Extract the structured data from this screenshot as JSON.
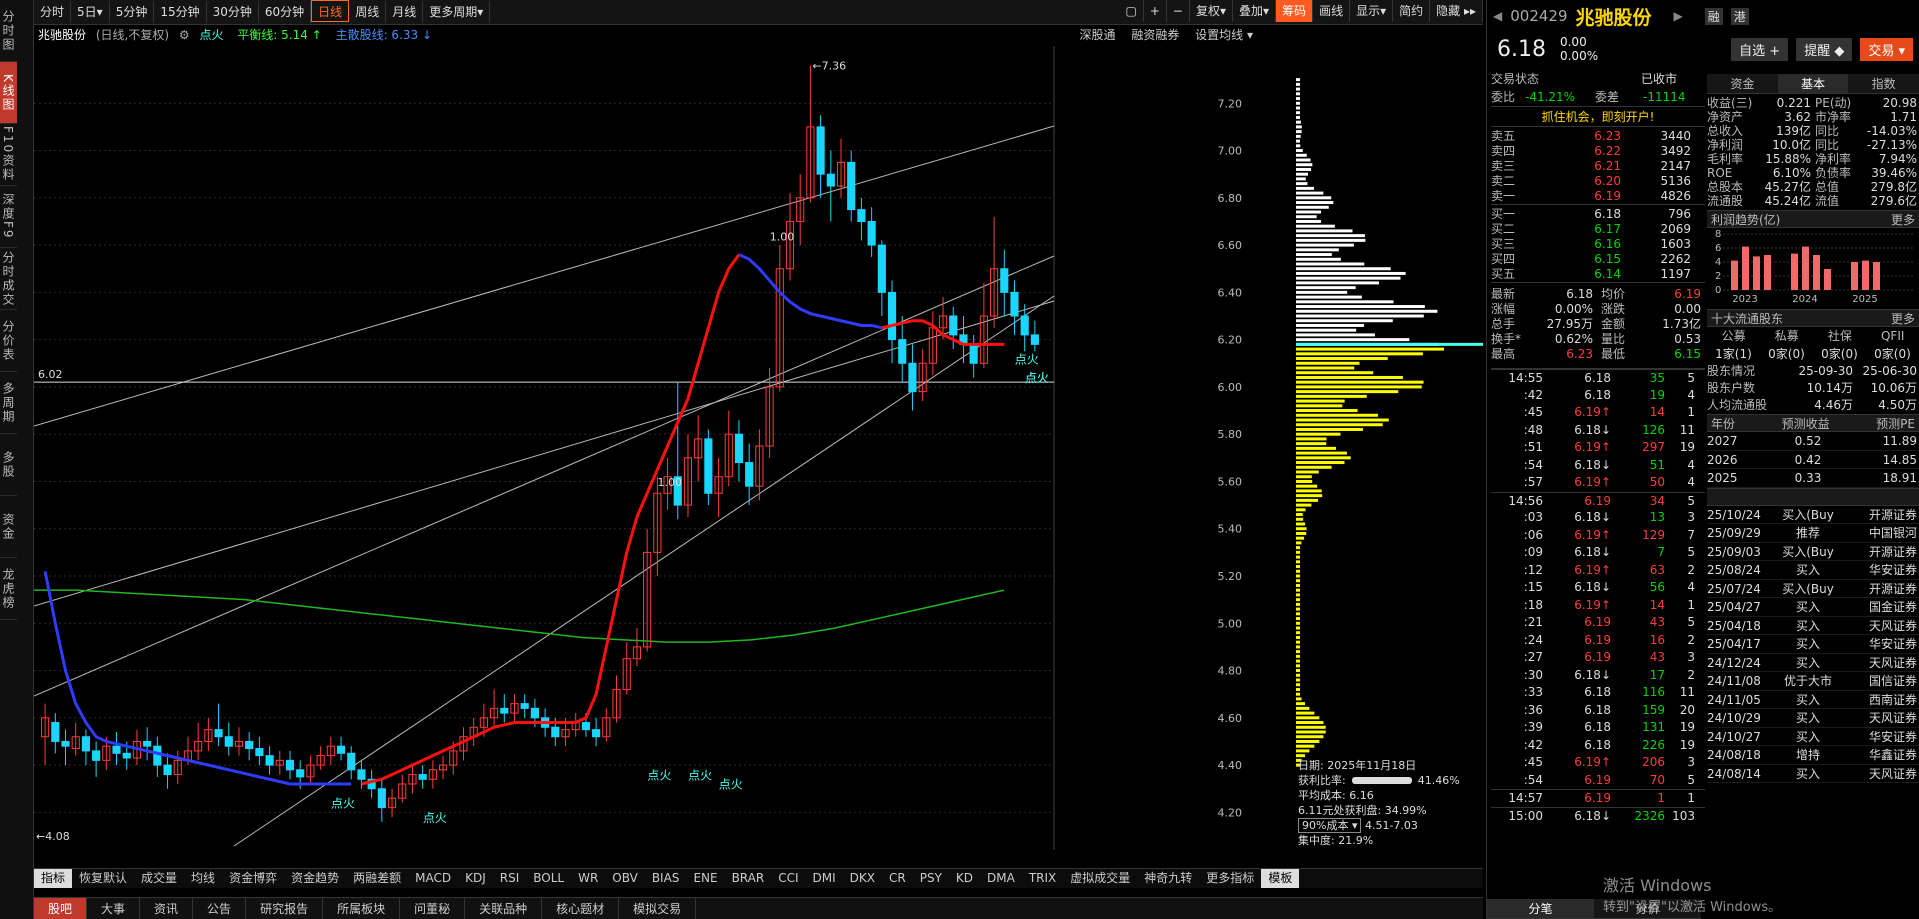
{
  "nav": [
    "分时图",
    "K线图",
    "F10资料",
    "深度F9",
    "分时成交",
    "分价表",
    "多周期",
    "多股",
    "资金",
    "龙虎榜"
  ],
  "nav_active": 1,
  "toolbar": {
    "left": [
      {
        "label": "分时"
      },
      {
        "label": "5日▾"
      },
      {
        "label": "5分钟"
      },
      {
        "label": "15分钟"
      },
      {
        "label": "30分钟"
      },
      {
        "label": "60分钟"
      },
      {
        "label": "日线",
        "active": true
      },
      {
        "label": "周线"
      },
      {
        "label": "月线"
      },
      {
        "label": "更多周期▾"
      }
    ],
    "right": [
      {
        "label": "▢"
      },
      {
        "label": "+"
      },
      {
        "label": "−"
      },
      {
        "label": "复权▾"
      },
      {
        "label": "叠加▾"
      },
      {
        "label": "筹码",
        "active": true
      },
      {
        "label": "画线"
      },
      {
        "label": "显示▾"
      },
      {
        "label": "简约"
      },
      {
        "label": "隐藏 ▸▸"
      }
    ]
  },
  "title": {
    "name": "兆驰股份",
    "mode": "(日线,不复权)",
    "gear": "⚙",
    "dianhuo": "点火",
    "pingheng": "平衡线: 5.14 ↑",
    "zhuli": "主散股线: 6.33 ↓",
    "right1": "深股通",
    "right2": "融资融券",
    "right3": "设置均线 ▾"
  },
  "chart_data": {
    "type": "candlestick",
    "title": "",
    "ylim": [
      4.1,
      7.4
    ],
    "yticks": [
      "7.20",
      "7.00",
      "6.80",
      "6.60",
      "6.40",
      "6.20",
      "6.00",
      "5.80",
      "5.60",
      "5.40",
      "5.20",
      "5.00",
      "4.80",
      "4.60",
      "4.40",
      "4.20"
    ],
    "hline": "6.02",
    "high_label": "←7.36",
    "low_label": "←4.08",
    "labels": [
      "1.00",
      "1.00"
    ],
    "dianhuo_labels": [
      "点火",
      "点火",
      "点火",
      "点火",
      "点火",
      "点火",
      "点火",
      "点火"
    ],
    "candles": [
      [
        4.52,
        4.6,
        4.66,
        4.4
      ],
      [
        4.58,
        4.5,
        4.62,
        4.45
      ],
      [
        4.5,
        4.48,
        4.55,
        4.4
      ],
      [
        4.47,
        4.52,
        4.58,
        4.44
      ],
      [
        4.52,
        4.46,
        4.55,
        4.4
      ],
      [
        4.46,
        4.42,
        4.5,
        4.35
      ],
      [
        4.42,
        4.48,
        4.52,
        4.38
      ],
      [
        4.48,
        4.45,
        4.54,
        4.4
      ],
      [
        4.45,
        4.43,
        4.5,
        4.38
      ],
      [
        4.43,
        4.5,
        4.55,
        4.4
      ],
      [
        4.5,
        4.48,
        4.56,
        4.42
      ],
      [
        4.48,
        4.4,
        4.52,
        4.35
      ],
      [
        4.4,
        4.36,
        4.45,
        4.3
      ],
      [
        4.36,
        4.42,
        4.46,
        4.32
      ],
      [
        4.42,
        4.46,
        4.52,
        4.4
      ],
      [
        4.46,
        4.5,
        4.58,
        4.42
      ],
      [
        4.5,
        4.55,
        4.6,
        4.46
      ],
      [
        4.55,
        4.52,
        4.66,
        4.48
      ],
      [
        4.52,
        4.48,
        4.58,
        4.44
      ],
      [
        4.48,
        4.5,
        4.56,
        4.44
      ],
      [
        4.5,
        4.47,
        4.54,
        4.42
      ],
      [
        4.47,
        4.44,
        4.52,
        4.4
      ],
      [
        4.44,
        4.4,
        4.48,
        4.36
      ],
      [
        4.4,
        4.42,
        4.46,
        4.36
      ],
      [
        4.42,
        4.38,
        4.46,
        4.34
      ],
      [
        4.38,
        4.35,
        4.42,
        4.3
      ],
      [
        4.35,
        4.4,
        4.44,
        4.32
      ],
      [
        4.4,
        4.44,
        4.48,
        4.38
      ],
      [
        4.44,
        4.48,
        4.52,
        4.4
      ],
      [
        4.48,
        4.45,
        4.52,
        4.42
      ],
      [
        4.45,
        4.38,
        4.48,
        4.34
      ],
      [
        4.38,
        4.34,
        4.42,
        4.3
      ],
      [
        4.34,
        4.3,
        4.38,
        4.26
      ],
      [
        4.3,
        4.22,
        4.34,
        4.16
      ],
      [
        4.22,
        4.26,
        4.3,
        4.18
      ],
      [
        4.26,
        4.32,
        4.36,
        4.24
      ],
      [
        4.32,
        4.36,
        4.4,
        4.28
      ],
      [
        4.36,
        4.34,
        4.4,
        4.3
      ],
      [
        4.34,
        4.38,
        4.42,
        4.3
      ],
      [
        4.38,
        4.4,
        4.44,
        4.34
      ],
      [
        4.4,
        4.46,
        4.5,
        4.36
      ],
      [
        4.46,
        4.52,
        4.56,
        4.42
      ],
      [
        4.52,
        4.56,
        4.6,
        4.48
      ],
      [
        4.56,
        4.6,
        4.66,
        4.52
      ],
      [
        4.6,
        4.64,
        4.72,
        4.56
      ],
      [
        4.64,
        4.62,
        4.7,
        4.58
      ],
      [
        4.62,
        4.66,
        4.7,
        4.58
      ],
      [
        4.66,
        4.64,
        4.7,
        4.6
      ],
      [
        4.64,
        4.6,
        4.68,
        4.56
      ],
      [
        4.6,
        4.56,
        4.64,
        4.52
      ],
      [
        4.56,
        4.52,
        4.6,
        4.48
      ],
      [
        4.52,
        4.55,
        4.6,
        4.48
      ],
      [
        4.55,
        4.58,
        4.62,
        4.52
      ],
      [
        4.58,
        4.55,
        4.62,
        4.52
      ],
      [
        4.55,
        4.52,
        4.6,
        4.48
      ],
      [
        4.52,
        4.6,
        4.64,
        4.5
      ],
      [
        4.6,
        4.72,
        4.78,
        4.58
      ],
      [
        4.72,
        4.85,
        4.92,
        4.7
      ],
      [
        4.85,
        4.9,
        4.98,
        4.82
      ],
      [
        4.9,
        5.3,
        5.4,
        4.88
      ],
      [
        5.3,
        5.55,
        5.62,
        5.2
      ],
      [
        5.55,
        5.62,
        5.7,
        5.48
      ],
      [
        5.62,
        5.5,
        6.02,
        5.44
      ],
      [
        5.5,
        5.7,
        5.8,
        5.45
      ],
      [
        5.7,
        5.78,
        5.88,
        5.6
      ],
      [
        5.78,
        5.55,
        5.82,
        5.5
      ],
      [
        5.55,
        5.62,
        5.7,
        5.45
      ],
      [
        5.62,
        5.8,
        5.9,
        5.58
      ],
      [
        5.8,
        5.68,
        5.86,
        5.6
      ],
      [
        5.68,
        5.58,
        5.76,
        5.5
      ],
      [
        5.58,
        5.75,
        5.82,
        5.52
      ],
      [
        5.75,
        6.0,
        6.08,
        5.7
      ],
      [
        6.0,
        6.5,
        6.6,
        5.98
      ],
      [
        6.5,
        6.7,
        6.82,
        6.45
      ],
      [
        6.7,
        6.8,
        6.9,
        6.6
      ],
      [
        6.8,
        7.1,
        7.36,
        6.78
      ],
      [
        7.1,
        6.9,
        7.15,
        6.8
      ],
      [
        6.9,
        6.85,
        7.0,
        6.7
      ],
      [
        6.85,
        6.95,
        7.05,
        6.8
      ],
      [
        6.95,
        6.75,
        7.0,
        6.7
      ],
      [
        6.75,
        6.7,
        6.8,
        6.62
      ],
      [
        6.7,
        6.6,
        6.76,
        6.55
      ],
      [
        6.6,
        6.4,
        6.62,
        6.3
      ],
      [
        6.4,
        6.2,
        6.45,
        6.1
      ],
      [
        6.2,
        6.1,
        6.3,
        6.02
      ],
      [
        6.1,
        5.98,
        6.18,
        5.9
      ],
      [
        5.98,
        6.1,
        6.16,
        5.94
      ],
      [
        6.1,
        6.25,
        6.32,
        6.05
      ],
      [
        6.25,
        6.3,
        6.38,
        6.2
      ],
      [
        6.3,
        6.22,
        6.34,
        6.16
      ],
      [
        6.22,
        6.18,
        6.3,
        6.1
      ],
      [
        6.18,
        6.1,
        6.22,
        6.04
      ],
      [
        6.1,
        6.3,
        6.44,
        6.08
      ],
      [
        6.3,
        6.5,
        6.72,
        6.25
      ],
      [
        6.5,
        6.4,
        6.58,
        6.3
      ],
      [
        6.4,
        6.3,
        6.45,
        6.22
      ],
      [
        6.3,
        6.22,
        6.35,
        6.15
      ],
      [
        6.22,
        6.18,
        6.28,
        6.15
      ]
    ],
    "ma_blue": [
      5.22,
      5.0,
      4.8,
      4.66,
      4.58,
      4.52,
      4.5,
      4.49,
      4.48,
      4.47,
      4.46,
      4.45,
      4.44,
      4.43,
      4.42,
      4.41,
      4.4,
      4.39,
      4.38,
      4.37,
      4.36,
      4.35,
      4.34,
      4.33,
      4.32,
      4.32,
      4.32,
      4.32,
      4.32,
      4.32,
      4.32
    ],
    "ma_red_start": 31,
    "ma_red": [
      4.32,
      4.33,
      4.34,
      4.36,
      4.38,
      4.4,
      4.42,
      4.44,
      4.46,
      4.48,
      4.5,
      4.52,
      4.54,
      4.56,
      4.57,
      4.58,
      4.58,
      4.58,
      4.58,
      4.58,
      4.58,
      4.58,
      4.6,
      4.7,
      4.9,
      5.1,
      5.3,
      5.45,
      5.55,
      5.65,
      5.75,
      5.85,
      5.95,
      6.1,
      6.25,
      6.4,
      6.5,
      6.56
    ],
    "ma_blue2_start": 68,
    "ma_blue2": [
      6.56,
      6.54,
      6.5,
      6.45,
      6.4,
      6.36,
      6.33,
      6.31,
      6.3,
      6.29,
      6.28,
      6.27,
      6.26,
      6.26,
      6.25
    ],
    "ma_red2_start": 82,
    "ma_red2": [
      6.25,
      6.26,
      6.27,
      6.28,
      6.28,
      6.26,
      6.22,
      6.2,
      6.18,
      6.18,
      6.18,
      6.18,
      6.18
    ],
    "green_line": [
      5.14,
      5.14,
      5.13,
      5.12,
      5.11,
      5.1,
      5.08,
      5.06,
      5.04,
      5.02,
      5.0,
      4.98,
      4.96,
      4.94,
      4.93,
      4.92,
      4.92,
      4.93,
      4.95,
      4.98,
      5.02,
      5.06,
      5.1,
      5.14
    ],
    "profile": {
      "date": "日期: 2025年11月18日",
      "win_rate": "获利比率:",
      "win_val": "41.46%",
      "avg": "平均成本: 6.16",
      "avg2": "6.11元处获利盘: 34.99%",
      "cost": "90%成本 ▾",
      "cost_range": "4.51-7.03",
      "concentration": "集中度: 21.9%"
    }
  },
  "bottom_tabs": [
    "指标",
    "恢复默认",
    "成交量",
    "均线",
    "资金博弈",
    "资金趋势",
    "两融差额",
    "MACD",
    "KDJ",
    "RSI",
    "BOLL",
    "WR",
    "OBV",
    "BIAS",
    "ENE",
    "BRAR",
    "CCI",
    "DMI",
    "DKX",
    "CR",
    "PSY",
    "KD",
    "DMA",
    "TRIX",
    "虚拟成交量",
    "神奇九转",
    "更多指标",
    "模板"
  ],
  "news_tabs": [
    "股吧",
    "大事",
    "资讯",
    "公告",
    "研究报告",
    "所属板块",
    "问董秘",
    "关联品种",
    "核心题材",
    "模拟交易"
  ],
  "quote": {
    "code": "002429",
    "name": "兆驰股份",
    "badge1": "融",
    "badge2": "港",
    "price": "6.18",
    "chg": "0.00",
    "pct": "0.00%",
    "zixuan": "自选 +",
    "tixing": "提醒 ◆",
    "jiaoyi": "交易 ▾",
    "status_label": "交易状态",
    "status_val": "已收市",
    "weibi_label": "委比",
    "weibi": "-41.21%",
    "weicha_label": "委差",
    "weicha": "-11114",
    "promo": "抓住机会，即刻开户!",
    "asks": [
      [
        "卖五",
        "6.23",
        "3440"
      ],
      [
        "卖四",
        "6.22",
        "3492"
      ],
      [
        "卖三",
        "6.21",
        "2147"
      ],
      [
        "卖二",
        "6.20",
        "5136"
      ],
      [
        "卖一",
        "6.19",
        "4826"
      ]
    ],
    "bids": [
      [
        "买一",
        "6.18",
        "796"
      ],
      [
        "买二",
        "6.17",
        "2069"
      ],
      [
        "买三",
        "6.16",
        "1603"
      ],
      [
        "买四",
        "6.15",
        "2262"
      ],
      [
        "买五",
        "6.14",
        "1197"
      ]
    ],
    "stats": [
      [
        "最新",
        "6.18",
        "均价",
        "6.19"
      ],
      [
        "涨幅",
        "0.00%",
        "涨跌",
        "0.00"
      ],
      [
        "总手",
        "27.95万",
        "金额",
        "1.73亿"
      ],
      [
        "换手*",
        "0.62%",
        "量比",
        "0.53"
      ],
      [
        "最高",
        "6.23",
        "最低",
        "6.15"
      ]
    ],
    "ticks": [
      [
        "14:55",
        "6.18",
        "35",
        "5",
        "g"
      ],
      [
        ":42",
        "6.18",
        "19",
        "4",
        "g"
      ],
      [
        ":45",
        "6.19↑",
        "14",
        "1",
        "r"
      ],
      [
        ":48",
        "6.18↓",
        "126",
        "11",
        "g"
      ],
      [
        ":51",
        "6.19↑",
        "297",
        "19",
        "r"
      ],
      [
        ":54",
        "6.18↓",
        "51",
        "4",
        "g"
      ],
      [
        ":57",
        "6.19↑",
        "50",
        "4",
        "r"
      ],
      [
        "14:56",
        "6.19",
        "34",
        "5",
        "r"
      ],
      [
        ":03",
        "6.18↓",
        "13",
        "3",
        "g"
      ],
      [
        ":06",
        "6.19↑",
        "129",
        "7",
        "r"
      ],
      [
        ":09",
        "6.18↓",
        "7",
        "5",
        "g"
      ],
      [
        ":12",
        "6.19↑",
        "63",
        "2",
        "r"
      ],
      [
        ":15",
        "6.18↓",
        "56",
        "4",
        "g"
      ],
      [
        ":18",
        "6.19↑",
        "14",
        "1",
        "r"
      ],
      [
        ":21",
        "6.19",
        "43",
        "5",
        "r"
      ],
      [
        ":24",
        "6.19",
        "16",
        "2",
        "r"
      ],
      [
        ":27",
        "6.19",
        "43",
        "3",
        "r"
      ],
      [
        ":30",
        "6.18↓",
        "17",
        "2",
        "g"
      ],
      [
        ":33",
        "6.18",
        "116",
        "11",
        "g"
      ],
      [
        ":36",
        "6.18",
        "159",
        "20",
        "g"
      ],
      [
        ":39",
        "6.18",
        "131",
        "19",
        "g"
      ],
      [
        ":42",
        "6.18",
        "226",
        "19",
        "g"
      ],
      [
        ":45",
        "6.19↑",
        "206",
        "3",
        "r"
      ],
      [
        ":54",
        "6.19",
        "70",
        "5",
        "r"
      ],
      [
        "14:57",
        "6.19",
        "1",
        "1",
        "r"
      ],
      [
        "15:00",
        "6.18↓",
        "2326",
        "103",
        "g"
      ]
    ],
    "ticks_tabs": [
      "分笔",
      "分价"
    ],
    "fin_tabs": [
      "资金",
      "基本",
      "指数"
    ],
    "fin": [
      [
        "收益(三)",
        "0.221",
        "PE(动)",
        "20.98"
      ],
      [
        "净资产",
        "3.62",
        "市净率",
        "1.71"
      ],
      [
        "总收入",
        "139亿",
        "同比",
        "-14.03%"
      ],
      [
        "净利润",
        "10.0亿",
        "同比",
        "-27.13%"
      ],
      [
        "毛利率",
        "15.88%",
        "净利率",
        "7.94%"
      ],
      [
        "ROE",
        "6.10%",
        "负债率",
        "39.46%"
      ],
      [
        "总股本",
        "45.27亿",
        "总值",
        "279.8亿"
      ],
      [
        "流通股",
        "45.24亿",
        "流值",
        "279.6亿"
      ]
    ],
    "profit_title": "利润趋势(亿)",
    "more": "更多",
    "profit_bars": [
      {
        "year": "2023",
        "values": [
          4.2,
          6.2,
          4.8,
          5.0
        ]
      },
      {
        "year": "2024",
        "values": [
          5.2,
          6.2,
          5.0,
          3.0
        ]
      },
      {
        "year": "2025",
        "values": [
          4.0,
          4.2,
          4.0
        ]
      }
    ],
    "profit_yticks": [
      "8",
      "6",
      "4",
      "2",
      "0"
    ],
    "holders_title": "十大流通股东",
    "holders_cols": [
      "公募",
      "私募",
      "社保",
      "QFII"
    ],
    "holders_vals": [
      "1家(1)",
      "0家(0)",
      "0家(0)",
      "0家(0)"
    ],
    "holder_info": [
      [
        "股东情况",
        "25-09-30",
        "25-06-30"
      ],
      [
        "股东户数",
        "10.14万",
        "10.06万"
      ],
      [
        "人均流通股",
        "4.46万",
        "4.50万"
      ]
    ],
    "forecast_hdr": [
      "年份",
      "预测收益",
      "预测PE"
    ],
    "forecast": [
      [
        "2027",
        "0.52",
        "11.89"
      ],
      [
        "2026",
        "0.42",
        "14.85"
      ],
      [
        "2025",
        "0.33",
        "18.91"
      ]
    ],
    "rating_hdr": [
      "日期",
      "评级",
      "机构名称"
    ],
    "ratings": [
      [
        "25/10/24",
        "买入(Buy",
        "开源证券"
      ],
      [
        "25/09/29",
        "推荐",
        "中国银河"
      ],
      [
        "25/09/03",
        "买入(Buy",
        "开源证券"
      ],
      [
        "25/08/24",
        "买入",
        "华安证券"
      ],
      [
        "25/07/24",
        "买入(Buy",
        "开源证券"
      ],
      [
        "25/04/27",
        "买入",
        "国金证券"
      ],
      [
        "25/04/18",
        "买入",
        "天风证券"
      ],
      [
        "25/04/17",
        "买入",
        "华安证券"
      ],
      [
        "24/12/24",
        "买入",
        "天风证券"
      ],
      [
        "24/11/08",
        "优于大市",
        "国信证券"
      ],
      [
        "24/11/05",
        "买入",
        "西南证券"
      ],
      [
        "24/10/29",
        "买入",
        "天风证券"
      ],
      [
        "24/10/27",
        "买入",
        "华安证券"
      ],
      [
        "24/08/18",
        "增持",
        "华鑫证券"
      ],
      [
        "24/08/14",
        "买入",
        "天风证券"
      ]
    ]
  },
  "watermark1": "激活 Windows",
  "watermark2": "转到\"设置\"以激活 Windows。"
}
